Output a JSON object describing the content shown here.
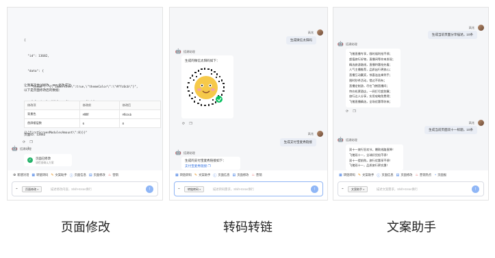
{
  "panel1": {
    "code_lines": [
      "{",
      "  \"id\": 13682,",
      "  \"data\": {",
      "    \"theme\": \"{\\\"immersive\\\":true,\\\"themeColor\\\":\\\"#ffc0cb\\\"}\",",
      "    \"plugins\": \"{\\\"pcraft-page-config\\\":",
      "{\\\"enable\\\":true,\\\"advancedConfig\\\":",
      "{\\\"firstScreenModulesAmount\\\":8}}}\"",
      "  }",
      "}"
    ],
    "result_line1": "让我再次尝试修改。### 修改成功",
    "result_line2": "以下是页面修改后的数据：",
    "table": {
      "headers": [
        "修改项",
        "修改前",
        "修改后"
      ],
      "rows": [
        [
          "背景色",
          "#ffffff",
          "#ffc0cb"
        ],
        [
          "首屏楼层数",
          "6",
          "8"
        ]
      ]
    },
    "page_id": "页面ID：13682",
    "bot_name": "搭建助理",
    "success_title": "页面已修改",
    "success_sub": "请检查确认方案"
  },
  "panel2": {
    "user_name": "高兆",
    "user_msg1": "生成微信太阳码",
    "bot_name": "搭建助理",
    "bot_msg1": "生成的微信太阳码如下：",
    "user_msg2": "生成支付宝麦秀链接",
    "bot_msg2": "生成的支付宝麦秀链接如下：",
    "bot_link": "支付宝麦秀链接"
  },
  "panel3": {
    "user_name": "高兆",
    "user_msg1": "生成当前页面分享描述。10条",
    "bot_name": "搭建助理",
    "bot_lines": [
      "飞猪直播专享，限时福利抢不停；",
      "超值旅行好物，直播间等你来发现；",
      "精选旅游路线，直播特惠抢先看；",
      "人气主播推荐，品质出行更放心；",
      "直播互动赢奖，惊喜连连拿到手；",
      "限时秒杀活动，错过不再有；",
      "直播定制游，尽在飞猪直播间；",
      "特价机票酒店，一网打尽超划算；",
      "旅行达人分享，实用攻略免费得；",
      "飞猪直播精选，全场优惠等你来；"
    ],
    "user_msg2": "生成当前页面双十一标题。10条",
    "bot_lines2": [
      "双十一旅行狂欢节，爆款线路直降！",
      "飞猪双十一，全球好货抢不停！",
      "双十一提前购，旅行优惠享不停！",
      "飞猪双十一，品质旅行更实惠！"
    ]
  },
  "toolbar": {
    "p1": [
      "新建对话",
      "转链转码",
      "文案助手",
      "页面信息",
      "页面修改",
      "营销"
    ],
    "p2": [
      "转链转码",
      "文案助手",
      "页面信息",
      "页面修改",
      "营销"
    ],
    "p3": [
      "转链转码",
      "文案助手",
      "页面信息",
      "页面修改",
      "营销热点",
      "页面报"
    ]
  },
  "input": {
    "chip_p1": "页面修改",
    "chip_p2": "转链转码",
    "chip_p3": "文案助手",
    "placeholder_p1": "描述修改内容，Shift+Enter换行",
    "placeholder_p2": "描述转码需求，Shift+Enter换行",
    "placeholder_p3": "描述文案需求，Shift+Enter换行"
  },
  "captions": [
    "页面修改",
    "转码转链",
    "文案助手"
  ],
  "colors": {
    "accent": "#2f6fe0",
    "send": "#8fb6f6",
    "success": "#26b36b"
  }
}
